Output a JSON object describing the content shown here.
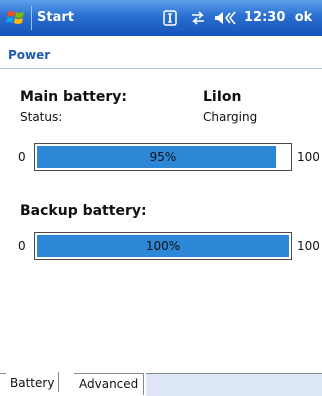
{
  "titlebar": {
    "title": "Start",
    "time": "12:30",
    "ok_label": "ok"
  },
  "page": {
    "title": "Power"
  },
  "main_battery": {
    "label": "Main battery:",
    "type": "LiIon",
    "status_label": "Status:",
    "status_value": "Charging",
    "min": "0",
    "max": "100",
    "percent_text": "95%",
    "level": 95
  },
  "backup_battery": {
    "label": "Backup battery:",
    "min": "0",
    "max": "100",
    "percent_text": "100%",
    "level": 100
  },
  "tabs": [
    {
      "label": "Battery",
      "active": true
    },
    {
      "label": "Advanced",
      "active": false
    }
  ],
  "colors": {
    "accent": "#1f5bb5",
    "bar_fill": "#2c87d6",
    "titlebar": "#1553b8"
  }
}
